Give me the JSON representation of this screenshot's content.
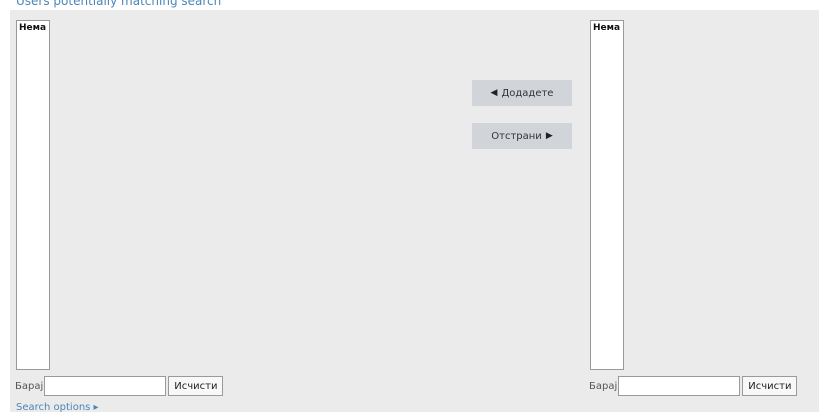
{
  "header": {
    "partial_text": "Users potentially matching search"
  },
  "left_list": {
    "options": [
      "Нема"
    ],
    "search_label": "Барај",
    "search_value": "",
    "clear_label": "Исчисти",
    "search_options_link": "Search options ▸"
  },
  "right_list": {
    "options": [
      "Нема"
    ],
    "search_label": "Барај",
    "search_value": "",
    "clear_label": "Исчисти"
  },
  "actions": {
    "add_label": "Додадете",
    "add_arrow": "◀",
    "remove_label": "Отстрани",
    "remove_arrow": "▶"
  },
  "colors": {
    "panel_background": "#ebebeb",
    "button_background": "#d1d5da",
    "link_color": "#4a86b8"
  }
}
